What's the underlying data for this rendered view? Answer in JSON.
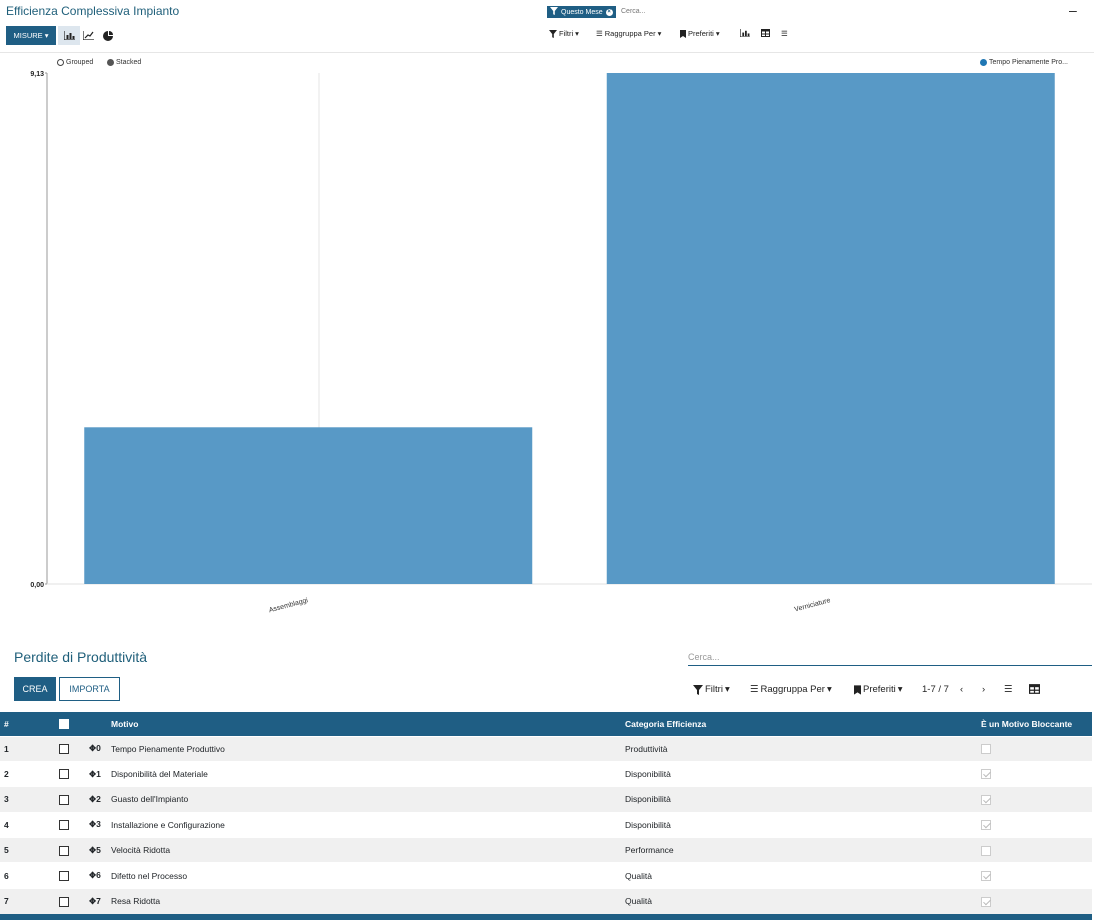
{
  "header": {
    "title": "Efficienza Complessiva Impianto",
    "facet_label": "Questo Mese",
    "search_placeholder": "Cerca...",
    "collapse_symbol": "–",
    "measures_label": "MISURE",
    "filters_label": "Filtri",
    "groupby_label": "Raggruppa Per",
    "favorites_label": "Preferiti"
  },
  "chart_legend": {
    "grouped_label": "Grouped",
    "stacked_label": "Stacked"
  },
  "chart_data": {
    "type": "bar",
    "categories": [
      "Assemblaggi",
      "Verniciature"
    ],
    "series": [
      {
        "name": "Tempo Pienamente Pro...",
        "values": [
          2.8,
          9.13
        ]
      }
    ],
    "ylim": [
      0,
      9.13
    ],
    "y_ticks": [
      "0,00",
      "9,13"
    ],
    "legend_position": "top-right",
    "bar_color": "#5899c6"
  },
  "list": {
    "title": "Perdite di Produttività",
    "create_label": "CREA",
    "import_label": "IMPORTA",
    "search_placeholder": "Cerca...",
    "filters_label": "Filtri",
    "groupby_label": "Raggruppa Per",
    "favorites_label": "Preferiti",
    "pager": "1-7 / 7",
    "columns": [
      "#",
      "",
      "",
      "Motivo",
      "Categoria Efficienza",
      "È un Motivo Bloccante"
    ],
    "rows": [
      {
        "num": "1",
        "seq": "0",
        "motivo": "Tempo Pienamente Produttivo",
        "categoria": "Produttività",
        "bloccante": false
      },
      {
        "num": "2",
        "seq": "1",
        "motivo": "Disponibilità del Materiale",
        "categoria": "Disponibilità",
        "bloccante": true
      },
      {
        "num": "3",
        "seq": "2",
        "motivo": "Guasto dell'Impianto",
        "categoria": "Disponibilità",
        "bloccante": true
      },
      {
        "num": "4",
        "seq": "3",
        "motivo": "Installazione e Configurazione",
        "categoria": "Disponibilità",
        "bloccante": true
      },
      {
        "num": "5",
        "seq": "5",
        "motivo": "Velocità Ridotta",
        "categoria": "Performance",
        "bloccante": false
      },
      {
        "num": "6",
        "seq": "6",
        "motivo": "Difetto nel Processo",
        "categoria": "Qualità",
        "bloccante": true
      },
      {
        "num": "7",
        "seq": "7",
        "motivo": "Resa Ridotta",
        "categoria": "Qualità",
        "bloccante": true
      }
    ]
  },
  "colors": {
    "primary": "#1f5e84",
    "bar": "#5899c6",
    "title": "#1f5f7a"
  }
}
